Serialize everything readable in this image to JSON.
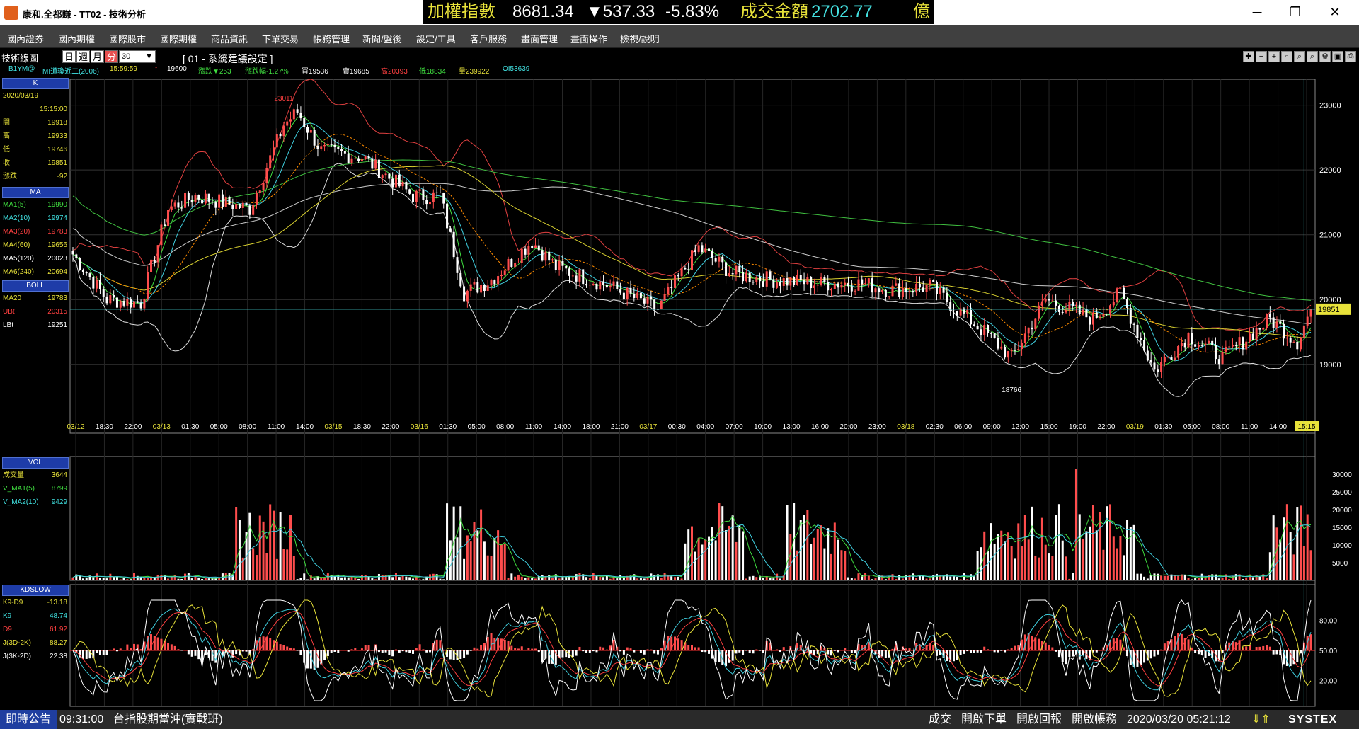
{
  "window": {
    "title": "康和.全都賺 - TT02 - 技術分析"
  },
  "ticker": {
    "index_name": "加權指數",
    "index_value": "8681.34",
    "change": "▼537.33",
    "pct": "-5.83%",
    "turnover_label": "成交金額",
    "turnover": "2702.77",
    "unit": "億",
    "colors": {
      "name": "#e8e23a",
      "value": "#ffffff",
      "down": "#ffffff",
      "amount": "#44e0e0"
    }
  },
  "menu": [
    "國內證券",
    "國內期權",
    "國際股市",
    "國際期權",
    "商品資訊",
    "下單交易",
    "帳務管理",
    "新聞/盤後",
    "設定/工具",
    "客戶服務",
    "畫面管理",
    "畫面操作",
    "檢視/說明"
  ],
  "toolbar": {
    "title": "技術線圖",
    "periods": [
      "日",
      "週",
      "月",
      "分"
    ],
    "interval": "30",
    "config": "[ 01 - 系統建議設定 ]"
  },
  "info": {
    "symbol": "B1YM@",
    "name": "MI道瓊近二(2006)",
    "time": "15:59:59",
    "arrow": "↑",
    "last": "19600",
    "chg": "漲跌▼253",
    "chgpct": "漲跌幅-1.27%",
    "buy": "買19536",
    "sell": "賣19685",
    "high": "高20393",
    "low": "低18834",
    "vol": "量239922",
    "oi": "OI53639"
  },
  "k_panel": {
    "head": "K",
    "date": "2020/03/19",
    "time": "15:15:00",
    "rows": [
      {
        "l": "開",
        "v": "19918"
      },
      {
        "l": "高",
        "v": "19933"
      },
      {
        "l": "低",
        "v": "19746"
      },
      {
        "l": "收",
        "v": "19851"
      },
      {
        "l": "漲跌",
        "v": "-92"
      }
    ]
  },
  "ma_panel": {
    "head": "MA",
    "rows": [
      {
        "l": "MA1(5)",
        "v": "19990",
        "c": "#40e040"
      },
      {
        "l": "MA2(10)",
        "v": "19974",
        "c": "#40e0e0"
      },
      {
        "l": "MA3(20)",
        "v": "19783",
        "c": "#ff4040"
      },
      {
        "l": "MA4(60)",
        "v": "19656",
        "c": "#e8e23a"
      },
      {
        "l": "MA5(120)",
        "v": "20023",
        "c": "#ffffff"
      },
      {
        "l": "MA6(240)",
        "v": "20694",
        "c": "#e8e23a"
      }
    ]
  },
  "boll_panel": {
    "head": "BOLL",
    "rows": [
      {
        "l": "MA20",
        "v": "19783",
        "c": "#e8e23a"
      },
      {
        "l": "UBt",
        "v": "20315",
        "c": "#ff4040"
      },
      {
        "l": "LBt",
        "v": "19251",
        "c": "#ffffff"
      }
    ]
  },
  "vol_panel": {
    "head": "VOL",
    "rows": [
      {
        "l": "成交量",
        "v": "3644",
        "c": "#e8e23a"
      },
      {
        "l": "V_MA1(5)",
        "v": "8799",
        "c": "#40e040"
      },
      {
        "l": "V_MA2(10)",
        "v": "9429",
        "c": "#40e0e0"
      }
    ]
  },
  "kd_panel": {
    "head": "KDSLOW",
    "rows": [
      {
        "l": "K9-D9",
        "v": "-13.18",
        "c": "#e8e23a"
      },
      {
        "l": "K9",
        "v": "48.74",
        "c": "#40e0e0"
      },
      {
        "l": "D9",
        "v": "61.92",
        "c": "#ff4040"
      },
      {
        "l": "J(3D-2K)",
        "v": "88.27",
        "c": "#e8e23a"
      },
      {
        "l": "J(3K-2D)",
        "v": "22.38",
        "c": "#ffffff"
      }
    ]
  },
  "chart_data": {
    "type": "candlestick",
    "price_axis": {
      "ticks": [
        23000,
        22000,
        21000,
        20000,
        19000
      ],
      "range": [
        18200,
        23400
      ]
    },
    "last_price": "19851",
    "annotations": {
      "high": "23011",
      "low": "18766"
    },
    "time_labels": [
      {
        "t": "03/12",
        "y": true
      },
      {
        "t": "18:30"
      },
      {
        "t": "22:00"
      },
      {
        "t": "03/13",
        "y": true
      },
      {
        "t": "01:30"
      },
      {
        "t": "05:00"
      },
      {
        "t": "08:00"
      },
      {
        "t": "11:00"
      },
      {
        "t": "14:00"
      },
      {
        "t": "03/15",
        "y": true
      },
      {
        "t": "18:30"
      },
      {
        "t": "22:00"
      },
      {
        "t": "03/16",
        "y": true
      },
      {
        "t": "01:30"
      },
      {
        "t": "05:00"
      },
      {
        "t": "08:00"
      },
      {
        "t": "11:00"
      },
      {
        "t": "14:00"
      },
      {
        "t": "18:00"
      },
      {
        "t": "21:00"
      },
      {
        "t": "03/17",
        "y": true
      },
      {
        "t": "00:30"
      },
      {
        "t": "04:00"
      },
      {
        "t": "07:00"
      },
      {
        "t": "10:00"
      },
      {
        "t": "13:00"
      },
      {
        "t": "16:00"
      },
      {
        "t": "20:00"
      },
      {
        "t": "23:00"
      },
      {
        "t": "03/18",
        "y": true
      },
      {
        "t": "02:30"
      },
      {
        "t": "06:00"
      },
      {
        "t": "09:00"
      },
      {
        "t": "12:00"
      },
      {
        "t": "15:00"
      },
      {
        "t": "19:00"
      },
      {
        "t": "22:00"
      },
      {
        "t": "03/19",
        "y": true
      },
      {
        "t": "01:30"
      },
      {
        "t": "05:00"
      },
      {
        "t": "08:00"
      },
      {
        "t": "11:00"
      },
      {
        "t": "14:00"
      },
      {
        "t": "15:15",
        "hl": true
      }
    ],
    "close_anchors": [
      [
        0,
        20700
      ],
      [
        10,
        20000
      ],
      [
        20,
        19950
      ],
      [
        28,
        21400
      ],
      [
        36,
        21600
      ],
      [
        52,
        21400
      ],
      [
        62,
        22700
      ],
      [
        66,
        22900
      ],
      [
        73,
        22300
      ],
      [
        85,
        22200
      ],
      [
        100,
        21600
      ],
      [
        108,
        21600
      ],
      [
        115,
        20100
      ],
      [
        123,
        20300
      ],
      [
        135,
        20900
      ],
      [
        142,
        20500
      ],
      [
        158,
        20200
      ],
      [
        172,
        19850
      ],
      [
        184,
        20800
      ],
      [
        194,
        20400
      ],
      [
        206,
        20300
      ],
      [
        220,
        20250
      ],
      [
        232,
        20250
      ],
      [
        240,
        20150
      ],
      [
        252,
        20200
      ],
      [
        268,
        19500
      ],
      [
        276,
        19100
      ],
      [
        286,
        20000
      ],
      [
        300,
        19700
      ],
      [
        308,
        20100
      ],
      [
        318,
        18900
      ],
      [
        328,
        19450
      ],
      [
        338,
        19100
      ],
      [
        352,
        19700
      ],
      [
        360,
        19350
      ],
      [
        364,
        19851
      ]
    ],
    "bar_count": 365,
    "volume_axis": {
      "ticks": [
        30000,
        25000,
        20000,
        15000,
        10000,
        5000
      ],
      "max": 33000
    },
    "kd_axis": {
      "ticks": [
        80,
        50,
        20
      ]
    }
  },
  "status": {
    "announce": "即時公告",
    "time": "09:31:00",
    "news": "台指股期當沖(實戰班)",
    "btn1": "成交",
    "btn2": "開啟下單",
    "btn3": "開啟回報",
    "btn4": "開啟帳務",
    "datetime": "2020/03/20 05:21:12",
    "brand": "SYSTEX"
  }
}
